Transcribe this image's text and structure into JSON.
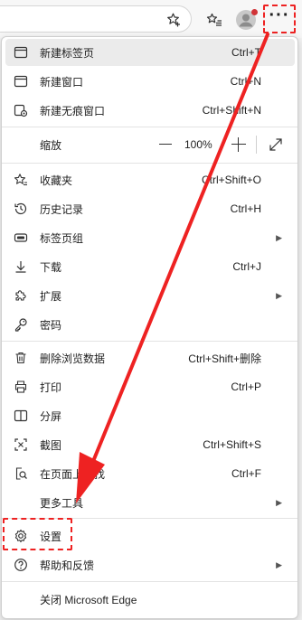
{
  "accent_color": "#ee2222",
  "toolbar": {
    "icons": [
      "favorite-star-icon",
      "collections-icon",
      "profile-avatar-icon",
      "more-options-icon"
    ],
    "more_label": "···"
  },
  "menu": {
    "new_tab": {
      "label": "新建标签页",
      "shortcut": "Ctrl+T"
    },
    "new_window": {
      "label": "新建窗口",
      "shortcut": "Ctrl+N"
    },
    "new_inprivate": {
      "label": "新建无痕窗口",
      "shortcut": "Ctrl+Shift+N"
    },
    "zoom": {
      "label": "缩放",
      "value": "100%"
    },
    "favorites": {
      "label": "收藏夹",
      "shortcut": "Ctrl+Shift+O"
    },
    "history": {
      "label": "历史记录",
      "shortcut": "Ctrl+H"
    },
    "tab_groups": {
      "label": "标签页组"
    },
    "downloads": {
      "label": "下载",
      "shortcut": "Ctrl+J"
    },
    "extensions": {
      "label": "扩展"
    },
    "passwords": {
      "label": "密码"
    },
    "clear_data": {
      "label": "删除浏览数据",
      "shortcut": "Ctrl+Shift+删除"
    },
    "print": {
      "label": "打印",
      "shortcut": "Ctrl+P"
    },
    "split_screen": {
      "label": "分屏"
    },
    "screenshot": {
      "label": "截图",
      "shortcut": "Ctrl+Shift+S"
    },
    "find": {
      "label": "在页面上查找",
      "shortcut": "Ctrl+F"
    },
    "more_tools": {
      "label": "更多工具"
    },
    "settings": {
      "label": "设置"
    },
    "help": {
      "label": "帮助和反馈"
    },
    "close": {
      "label": "关闭 Microsoft Edge"
    }
  }
}
